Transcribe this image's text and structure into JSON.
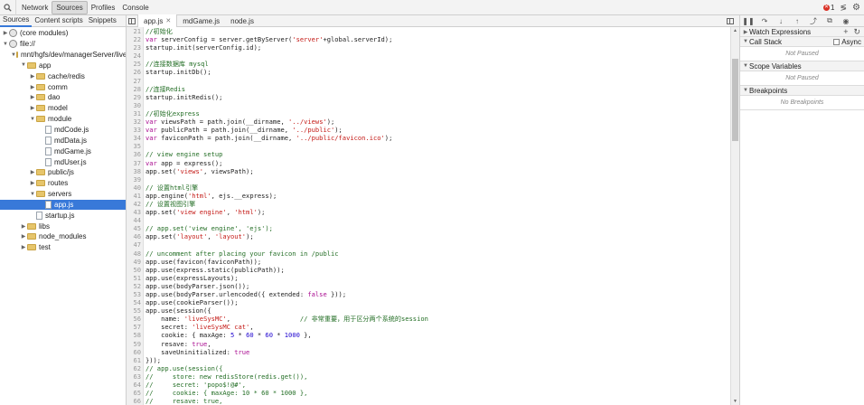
{
  "topbar": {
    "tabs": [
      "Network",
      "Sources",
      "Profiles",
      "Console"
    ],
    "active_tab": "Sources",
    "error_count": "1"
  },
  "navigator": {
    "tabs": [
      "Sources",
      "Content scripts",
      "Snippets"
    ],
    "tree": [
      {
        "label": "(core modules)",
        "depth": 0,
        "kind": "globe",
        "open": false
      },
      {
        "label": "file://",
        "depth": 0,
        "kind": "globe",
        "open": true
      },
      {
        "label": "mnt/hgfs/dev/managerServer/live",
        "depth": 1,
        "kind": "folder",
        "open": true
      },
      {
        "label": "app",
        "depth": 2,
        "kind": "folder",
        "open": true
      },
      {
        "label": "cache/redis",
        "depth": 3,
        "kind": "folder",
        "open": false
      },
      {
        "label": "comm",
        "depth": 3,
        "kind": "folder",
        "open": false
      },
      {
        "label": "dao",
        "depth": 3,
        "kind": "folder",
        "open": false
      },
      {
        "label": "model",
        "depth": 3,
        "kind": "folder",
        "open": false
      },
      {
        "label": "module",
        "depth": 3,
        "kind": "folder",
        "open": true
      },
      {
        "label": "mdCode.js",
        "depth": 4,
        "kind": "file"
      },
      {
        "label": "mdData.js",
        "depth": 4,
        "kind": "file"
      },
      {
        "label": "mdGame.js",
        "depth": 4,
        "kind": "file"
      },
      {
        "label": "mdUser.js",
        "depth": 4,
        "kind": "file"
      },
      {
        "label": "public/js",
        "depth": 3,
        "kind": "folder",
        "open": false
      },
      {
        "label": "routes",
        "depth": 3,
        "kind": "folder",
        "open": false
      },
      {
        "label": "servers",
        "depth": 3,
        "kind": "folder",
        "open": true
      },
      {
        "label": "app.js",
        "depth": 4,
        "kind": "file",
        "selected": true
      },
      {
        "label": "startup.js",
        "depth": 3,
        "kind": "file"
      },
      {
        "label": "libs",
        "depth": 2,
        "kind": "folder",
        "open": false
      },
      {
        "label": "node_modules",
        "depth": 2,
        "kind": "folder",
        "open": false
      },
      {
        "label": "test",
        "depth": 2,
        "kind": "folder",
        "open": false
      }
    ]
  },
  "editor": {
    "tabs": [
      {
        "label": "app.js",
        "active": true,
        "closable": true
      },
      {
        "label": "mdGame.js",
        "active": false
      },
      {
        "label": "node.js",
        "active": false
      }
    ],
    "lines": [
      {
        "n": "21",
        "t": "//初始化",
        "c": "com"
      },
      {
        "n": "22",
        "t": "var serverConfig = server.getByServer('server'+global.serverId);",
        "c": ""
      },
      {
        "n": "23",
        "t": "startup.init(serverConfig.id);",
        "c": ""
      },
      {
        "n": "24",
        "t": "",
        "c": ""
      },
      {
        "n": "25",
        "t": "//连接数据库 mysql",
        "c": "com"
      },
      {
        "n": "26",
        "t": "startup.initDb();",
        "c": ""
      },
      {
        "n": "27",
        "t": "",
        "c": ""
      },
      {
        "n": "28",
        "t": "//连接Redis",
        "c": "com"
      },
      {
        "n": "29",
        "t": "startup.initRedis();",
        "c": ""
      },
      {
        "n": "30",
        "t": "",
        "c": ""
      },
      {
        "n": "31",
        "t": "//初始化express",
        "c": "com"
      },
      {
        "n": "32",
        "t": "var viewsPath = path.join(__dirname, '../views');",
        "c": ""
      },
      {
        "n": "33",
        "t": "var publicPath = path.join(__dirname, '../public');",
        "c": ""
      },
      {
        "n": "34",
        "t": "var faviconPath = path.join(__dirname, '../public/favicon.ico');",
        "c": ""
      },
      {
        "n": "35",
        "t": "",
        "c": ""
      },
      {
        "n": "36",
        "t": "// view engine setup",
        "c": "com"
      },
      {
        "n": "37",
        "t": "var app = express();",
        "c": ""
      },
      {
        "n": "38",
        "t": "app.set('views', viewsPath);",
        "c": ""
      },
      {
        "n": "39",
        "t": "",
        "c": ""
      },
      {
        "n": "40",
        "t": "// 设置html引擎",
        "c": "com"
      },
      {
        "n": "41",
        "t": "app.engine('html', ejs.__express);",
        "c": ""
      },
      {
        "n": "42",
        "t": "// 设置视图引擎",
        "c": "com"
      },
      {
        "n": "43",
        "t": "app.set('view engine', 'html');",
        "c": ""
      },
      {
        "n": "44",
        "t": "",
        "c": ""
      },
      {
        "n": "45",
        "t": "// app.set('view engine', 'ejs');",
        "c": "com"
      },
      {
        "n": "46",
        "t": "app.set('layout', 'layout');",
        "c": ""
      },
      {
        "n": "47",
        "t": "",
        "c": ""
      },
      {
        "n": "48",
        "t": "// uncomment after placing your favicon in /public",
        "c": "com"
      },
      {
        "n": "49",
        "t": "app.use(favicon(faviconPath));",
        "c": ""
      },
      {
        "n": "50",
        "t": "app.use(express.static(publicPath));",
        "c": ""
      },
      {
        "n": "51",
        "t": "app.use(expressLayouts);",
        "c": ""
      },
      {
        "n": "52",
        "t": "app.use(bodyParser.json());",
        "c": ""
      },
      {
        "n": "53",
        "t": "app.use(bodyParser.urlencoded({ extended: false }));",
        "c": ""
      },
      {
        "n": "54",
        "t": "app.use(cookieParser());",
        "c": ""
      },
      {
        "n": "55",
        "t": "app.use(session({",
        "c": ""
      },
      {
        "n": "56",
        "t": "    name: 'liveSysMC',                  // 非常重要，用于区分两个系统的session",
        "c": ""
      },
      {
        "n": "57",
        "t": "    secret: 'liveSysMC cat',",
        "c": ""
      },
      {
        "n": "58",
        "t": "    cookie: { maxAge: 5 * 60 * 60 * 1000 },",
        "c": ""
      },
      {
        "n": "59",
        "t": "    resave: true,",
        "c": ""
      },
      {
        "n": "60",
        "t": "    saveUninitialized: true",
        "c": ""
      },
      {
        "n": "61",
        "t": "}));",
        "c": ""
      },
      {
        "n": "62",
        "t": "// app.use(session({",
        "c": "com"
      },
      {
        "n": "63",
        "t": "//     store: new redisStore(redis.get()),",
        "c": "com"
      },
      {
        "n": "64",
        "t": "//     secret: 'popo$!@#',",
        "c": "com"
      },
      {
        "n": "65",
        "t": "//     cookie: { maxAge: 10 * 60 * 1000 },",
        "c": "com"
      },
      {
        "n": "66",
        "t": "//     resave: true,",
        "c": "com"
      }
    ]
  },
  "sidebar": {
    "watch_label": "Watch Expressions",
    "callstack_label": "Call Stack",
    "async_label": "Async",
    "not_paused_1": "Not Paused",
    "scope_label": "Scope Variables",
    "not_paused_2": "Not Paused",
    "breakpoints_label": "Breakpoints",
    "no_breakpoints": "No Breakpoints"
  }
}
